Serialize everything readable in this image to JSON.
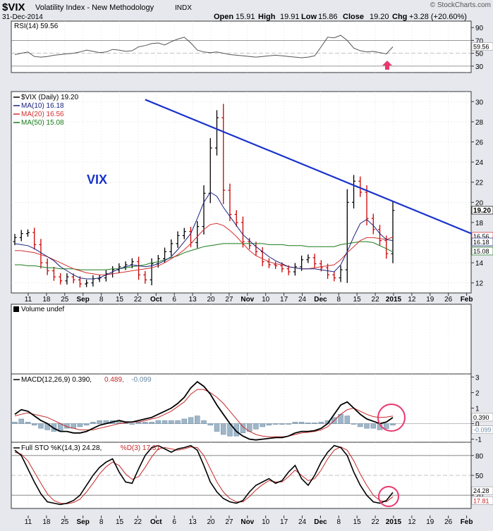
{
  "header": {
    "symbol": "$VIX",
    "name": "Volatility Index - New Methodology",
    "exchange": "INDX",
    "date": "31-Dec-2014",
    "ohlc": [
      {
        "label": "Open",
        "value": "15.91"
      },
      {
        "label": "High",
        "value": "19.91"
      },
      {
        "label": "Low",
        "value": "15.86"
      },
      {
        "label": "Close",
        "value": "19.20"
      },
      {
        "label": "Chg",
        "value": "+3.28 (+20.60%)"
      }
    ],
    "copyright": "© StockCharts.com"
  },
  "colors": {
    "panel_bg": "#ffffff",
    "outer_bg": "#e6e8ee",
    "up_bar": "#000000",
    "down_bar": "#cc0000",
    "ma10": "#1a237e",
    "ma20": "#d32f2f",
    "ma50": "#1b7a1b",
    "trendline": "#1a33cc",
    "rsi_line": "#555555",
    "macd_line": "#000000",
    "signal_line": "#c62828",
    "histogram": "#9fb6c8",
    "annotation": "#e8386d"
  },
  "annotations": {
    "vix_label": "VIX"
  },
  "x_axis": {
    "labels": [
      "11",
      "18",
      "25",
      "Sep",
      "8",
      "15",
      "22",
      "Oct",
      "6",
      "13",
      "20",
      "27",
      "Nov",
      "10",
      "17",
      "24",
      "Dec",
      "8",
      "15",
      "22",
      "2015",
      "12",
      "19",
      "26",
      "Feb"
    ],
    "bold_labels": [
      "Sep",
      "Oct",
      "Nov",
      "Dec",
      "2015",
      "Feb"
    ]
  },
  "chart_data": [
    {
      "type": "line",
      "panel": "rsi",
      "legend": "RSI(14) 59.56",
      "ylim": [
        20,
        100
      ],
      "yticks": [
        30,
        50,
        70,
        90
      ],
      "levels": [
        30,
        70
      ],
      "last_value": "59.56",
      "series": [
        {
          "name": "RSI(14)",
          "values": [
            48,
            50,
            52,
            45,
            44,
            45,
            47,
            48,
            49,
            50,
            52,
            55,
            53,
            51,
            52,
            56,
            55,
            53,
            54,
            60,
            62,
            65,
            66,
            63,
            68,
            72,
            75,
            66,
            55,
            52,
            51,
            52,
            50,
            48,
            47,
            46,
            45,
            44,
            45,
            46,
            47,
            46,
            45,
            44,
            43,
            44,
            46,
            60,
            75,
            74,
            78,
            70,
            58,
            54,
            52,
            53,
            51,
            49,
            60
          ]
        }
      ]
    },
    {
      "type": "line",
      "panel": "price",
      "legend": [
        {
          "name": "$VIX (Daily)",
          "value": "19.20"
        },
        {
          "name": "MA(10)",
          "value": "16.18"
        },
        {
          "name": "MA(20)",
          "value": "16.56"
        },
        {
          "name": "MA(50)",
          "value": "15.08"
        }
      ],
      "ylim": [
        11,
        31
      ],
      "yticks": [
        12,
        14,
        16,
        18,
        20,
        22,
        24,
        26,
        28,
        30
      ],
      "trendline": {
        "from": {
          "x": 20,
          "y": 30.2
        },
        "to": {
          "x": 58,
          "y": 20.1
        }
      },
      "last_labels": [
        "19.20",
        "16.56",
        "16.18",
        "15.08"
      ],
      "series": [
        {
          "name": "$VIX (Daily)",
          "values": [
            16.5,
            16.9,
            17.0,
            15.8,
            14.0,
            13.2,
            12.6,
            12.2,
            12.6,
            12.3,
            11.9,
            12.0,
            12.4,
            12.5,
            12.9,
            13.3,
            13.6,
            13.8,
            14.1,
            12.8,
            12.3,
            13.9,
            14.4,
            15.1,
            15.9,
            16.7,
            17.1,
            16.0,
            17.6,
            20.9,
            25.4,
            28.4,
            21.2,
            18.8,
            18.0,
            16.1,
            15.7,
            15.1,
            14.1,
            13.8,
            13.7,
            13.4,
            13.1,
            13.6,
            14.3,
            14.5,
            13.9,
            13.5,
            12.8,
            12.5,
            13.3,
            20.0,
            22.1,
            21.0,
            18.4,
            17.3,
            16.2,
            14.9,
            19.2
          ]
        },
        {
          "name": "MA(10)",
          "values": [
            15.9,
            15.8,
            15.7,
            15.4,
            15.0,
            14.6,
            14.2,
            13.6,
            13.2,
            12.8,
            12.5,
            12.4,
            12.4,
            12.5,
            12.8,
            13.1,
            13.4,
            13.6,
            13.8,
            13.7,
            13.6,
            13.7,
            13.9,
            14.2,
            14.6,
            15.3,
            16.1,
            16.9,
            18.4,
            20.0,
            21.0,
            20.6,
            19.5,
            18.6,
            17.7,
            16.8,
            16.2,
            15.6,
            15.1,
            14.6,
            14.2,
            13.9,
            13.6,
            13.5,
            13.4,
            13.4,
            13.4,
            13.3,
            13.2,
            13.1,
            13.8,
            15.1,
            16.6,
            17.9,
            18.3,
            17.7,
            16.9,
            16.3,
            16.2
          ]
        },
        {
          "name": "MA(20)",
          "values": [
            15.2,
            15.2,
            15.1,
            15.0,
            14.8,
            14.6,
            14.3,
            14.0,
            13.7,
            13.4,
            13.2,
            13.0,
            12.9,
            12.8,
            12.8,
            12.9,
            13.0,
            13.1,
            13.2,
            13.3,
            13.4,
            13.5,
            13.7,
            14.0,
            14.4,
            14.8,
            15.3,
            15.9,
            16.6,
            17.3,
            17.8,
            17.9,
            17.7,
            17.2,
            16.6,
            15.9,
            15.2,
            14.7,
            14.4,
            14.1,
            13.9,
            13.8,
            13.6,
            13.5,
            13.4,
            13.4,
            13.5,
            13.6,
            13.7,
            13.8,
            14.3,
            15.0,
            15.6,
            16.2,
            16.5,
            16.5,
            16.4,
            16.3,
            16.56
          ]
        },
        {
          "name": "MA(50)",
          "values": [
            13.8,
            13.8,
            13.7,
            13.7,
            13.6,
            13.5,
            13.5,
            13.4,
            13.4,
            13.4,
            13.3,
            13.3,
            13.3,
            13.3,
            13.3,
            13.4,
            13.4,
            13.5,
            13.6,
            13.7,
            13.8,
            14.0,
            14.1,
            14.3,
            14.5,
            14.7,
            15.0,
            15.2,
            15.4,
            15.6,
            15.7,
            15.8,
            15.9,
            15.9,
            15.9,
            15.9,
            15.9,
            15.9,
            15.9,
            15.8,
            15.8,
            15.8,
            15.7,
            15.7,
            15.7,
            15.6,
            15.6,
            15.6,
            15.6,
            15.6,
            15.8,
            15.9,
            16.0,
            16.1,
            16.1,
            16.0,
            15.7,
            15.4,
            15.08
          ]
        }
      ]
    },
    {
      "type": "bar",
      "panel": "volume",
      "legend": "Volume undef",
      "values": []
    },
    {
      "type": "line",
      "panel": "macd",
      "legend": [
        {
          "name": "MACD(12,26,9)",
          "value": "0.390"
        },
        {
          "name": "",
          "value": "0.489"
        },
        {
          "name": "",
          "value": "-0.099"
        }
      ],
      "ylim": [
        -1.2,
        3.2
      ],
      "yticks": [
        -1,
        0,
        1,
        2,
        3
      ],
      "last_labels": [
        "0.390",
        "-0.099"
      ],
      "series": [
        {
          "name": "MACD",
          "values": [
            0.6,
            0.9,
            0.8,
            0.5,
            0.2,
            0.0,
            -0.3,
            -0.5,
            -0.5,
            -0.6,
            -0.6,
            -0.5,
            -0.3,
            -0.1,
            0.0,
            0.1,
            0.2,
            0.1,
            0.1,
            0.2,
            0.3,
            0.4,
            0.6,
            0.8,
            1.0,
            1.3,
            1.7,
            2.3,
            2.7,
            2.4,
            1.9,
            1.2,
            0.6,
            0.0,
            -0.5,
            -0.8,
            -1.0,
            -1.05,
            -1.0,
            -0.95,
            -0.9,
            -0.9,
            -0.8,
            -0.6,
            -0.5,
            -0.5,
            -0.45,
            -0.3,
            0.0,
            0.6,
            1.2,
            1.4,
            1.0,
            0.6,
            0.3,
            0.15,
            0.0,
            0.1,
            0.39
          ]
        },
        {
          "name": "Signal",
          "values": [
            0.5,
            0.6,
            0.7,
            0.6,
            0.5,
            0.4,
            0.2,
            0.0,
            -0.2,
            -0.3,
            -0.4,
            -0.4,
            -0.4,
            -0.3,
            -0.2,
            -0.1,
            0.0,
            0.05,
            0.1,
            0.1,
            0.2,
            0.3,
            0.4,
            0.6,
            0.8,
            1.1,
            1.4,
            1.9,
            2.2,
            2.2,
            2.0,
            1.7,
            1.3,
            0.8,
            0.3,
            -0.2,
            -0.5,
            -0.7,
            -0.8,
            -0.85,
            -0.85,
            -0.85,
            -0.8,
            -0.7,
            -0.6,
            -0.55,
            -0.5,
            -0.4,
            -0.2,
            0.2,
            0.6,
            0.9,
            1.0,
            0.8,
            0.6,
            0.45,
            0.4,
            0.42,
            0.489
          ]
        },
        {
          "name": "Histogram",
          "values": [
            0.1,
            0.3,
            0.1,
            -0.1,
            -0.3,
            -0.4,
            -0.5,
            -0.5,
            -0.3,
            -0.3,
            -0.2,
            -0.1,
            0.1,
            0.2,
            0.2,
            0.2,
            0.2,
            0.05,
            0.0,
            0.1,
            0.1,
            0.1,
            0.2,
            0.2,
            0.2,
            0.2,
            0.3,
            0.4,
            0.5,
            0.2,
            -0.1,
            -0.5,
            -0.7,
            -0.8,
            -0.8,
            -0.6,
            -0.5,
            -0.35,
            -0.2,
            -0.1,
            -0.05,
            -0.05,
            0.0,
            0.1,
            0.1,
            0.05,
            0.05,
            0.1,
            0.2,
            0.4,
            0.6,
            0.5,
            0.0,
            -0.2,
            -0.3,
            -0.3,
            -0.4,
            -0.32,
            -0.099
          ]
        }
      ]
    },
    {
      "type": "line",
      "panel": "sto",
      "legend": [
        {
          "name": "Full STO %K(14,3)",
          "value": "24.28"
        },
        {
          "name": "%D(3)",
          "value": "17.81"
        }
      ],
      "ylim": [
        0,
        100
      ],
      "yticks": [
        20,
        50,
        80
      ],
      "levels": [
        20,
        80
      ],
      "last_labels": [
        "24.28",
        "17.81"
      ],
      "series": [
        {
          "name": "%K(14,3)",
          "values": [
            88,
            80,
            60,
            40,
            22,
            10,
            8,
            6,
            8,
            12,
            20,
            35,
            50,
            62,
            70,
            75,
            55,
            40,
            38,
            60,
            80,
            92,
            95,
            90,
            85,
            90,
            92,
            95,
            88,
            65,
            40,
            25,
            15,
            10,
            8,
            12,
            25,
            35,
            40,
            45,
            38,
            42,
            55,
            65,
            45,
            35,
            50,
            70,
            85,
            95,
            92,
            80,
            55,
            35,
            20,
            10,
            8,
            12,
            24.28
          ]
        },
        {
          "name": "%D(3)",
          "values": [
            85,
            82,
            72,
            55,
            38,
            22,
            12,
            8,
            7,
            9,
            14,
            25,
            38,
            52,
            63,
            70,
            65,
            52,
            44,
            48,
            62,
            78,
            90,
            92,
            90,
            88,
            90,
            93,
            92,
            80,
            60,
            40,
            25,
            15,
            10,
            10,
            18,
            28,
            36,
            42,
            40,
            40,
            48,
            58,
            50,
            42,
            45,
            58,
            75,
            88,
            93,
            88,
            72,
            52,
            35,
            20,
            12,
            10,
            17.81
          ]
        }
      ]
    }
  ]
}
